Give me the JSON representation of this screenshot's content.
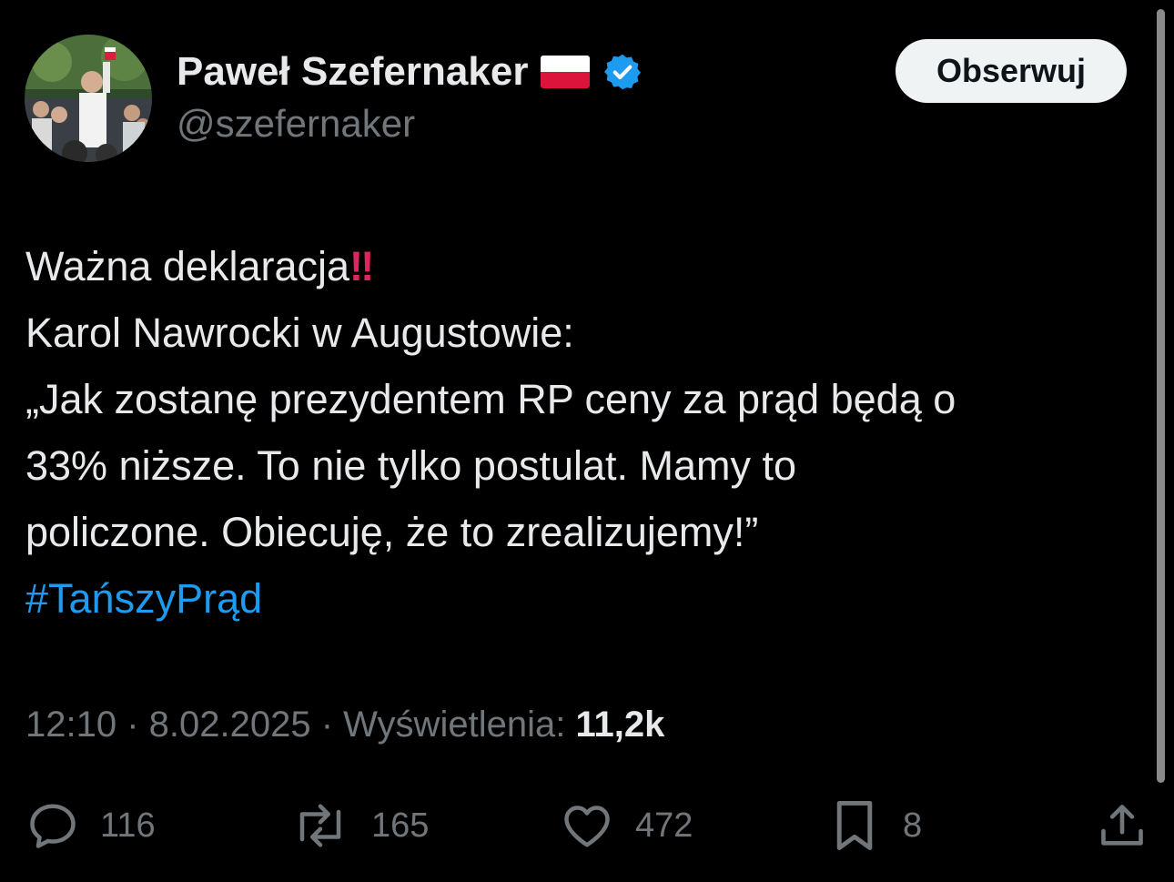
{
  "author": {
    "display_name": "Paweł Szefernaker",
    "handle": "@szefernaker",
    "flag_icon": "poland-flag-icon",
    "verified_icon": "verified-badge-icon",
    "verified_color": "#1d9bf0"
  },
  "follow_button": {
    "label": "Obserwuj"
  },
  "tweet": {
    "lines": [
      "Ważna deklaracja",
      "Karol Nawrocki w Augustowie:",
      "„Jak zostanę prezydentem RP ceny za prąd będą o",
      "33% niższe. To nie tylko postulat. Mamy to",
      "policzone. Obiecuję, że to zrealizujemy!”"
    ],
    "emoji_after_line_1": "‼",
    "hashtag": "#TańszyPrąd",
    "hashtag_color": "#1d9bf0"
  },
  "meta": {
    "time": "12:10",
    "separator": " · ",
    "date": "8.02.2025",
    "views_label": "Wyświetlenia:",
    "views_count": "11,2k"
  },
  "actions": {
    "replies": {
      "icon": "reply-icon",
      "count": "116"
    },
    "reposts": {
      "icon": "repost-icon",
      "count": "165"
    },
    "likes": {
      "icon": "heart-icon",
      "count": "472"
    },
    "bookmarks": {
      "icon": "bookmark-icon",
      "count": "8"
    },
    "share": {
      "icon": "share-icon"
    }
  }
}
